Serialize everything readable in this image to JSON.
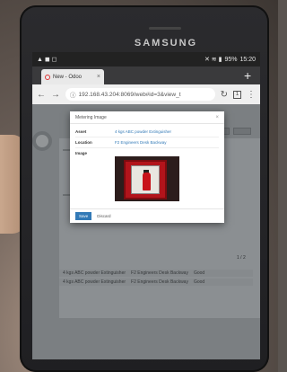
{
  "device": {
    "brand": "SAMSUNG"
  },
  "statusbar": {
    "battery": "95%",
    "time": "15:20",
    "left_icons": "▲ ◼ ◻",
    "right_icons": "✕ ≋ ▮"
  },
  "browser": {
    "tab_title": "New - Odoo",
    "tab_close": "×",
    "new_tab": "+",
    "url": "192.168.43.204:8069/web#id=3&view_t",
    "back_icon": "←",
    "forward_icon": "→",
    "info_icon": "ⓘ",
    "reload_icon": "↻",
    "tab_count": "1",
    "menu_icon": "⋮"
  },
  "modal": {
    "title": "Metering Image",
    "close": "×",
    "fields": [
      {
        "label": "Asset",
        "value": "4 kgs ABC powder Extinguisher"
      },
      {
        "label": "Location",
        "value": "F2 Engineers Desk Backway"
      },
      {
        "label": "Image",
        "value": ""
      }
    ],
    "save_label": "Save",
    "discard_label": "Discard"
  },
  "background_table": {
    "pager": "1 / 2",
    "rows": [
      {
        "asset": "4 kgs ABC powder Extinguisher",
        "location": "F2 Engineers Desk Backway",
        "status": "Good"
      },
      {
        "asset": "4 kgs ABC powder Extinguisher",
        "location": "F2 Engineers Desk Backway",
        "status": "Good"
      }
    ]
  }
}
